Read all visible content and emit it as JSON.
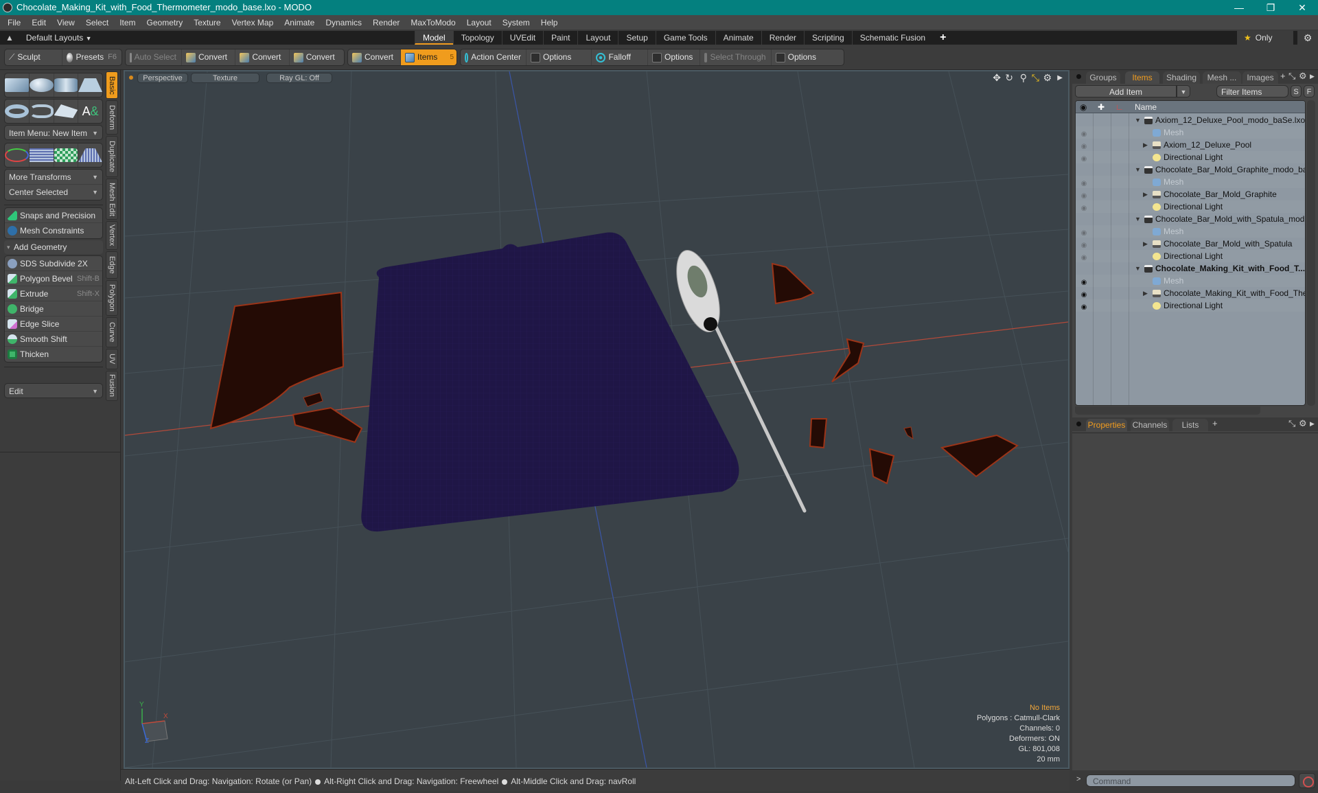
{
  "window": {
    "title": "Chocolate_Making_Kit_with_Food_Thermometer_modo_base.lxo - MODO",
    "controls": [
      "minimize",
      "restore",
      "close"
    ]
  },
  "menu": [
    "File",
    "Edit",
    "View",
    "Select",
    "Item",
    "Geometry",
    "Texture",
    "Vertex Map",
    "Animate",
    "Dynamics",
    "Render",
    "MaxToModo",
    "Layout",
    "System",
    "Help"
  ],
  "layoutbar": {
    "layouts_label": "Default Layouts",
    "tabs": [
      "Model",
      "Topology",
      "UVEdit",
      "Paint",
      "Layout",
      "Setup",
      "Game Tools",
      "Animate",
      "Render",
      "Scripting",
      "Schematic Fusion"
    ],
    "active_tab": "Model",
    "only_label": "Only"
  },
  "toolbar": {
    "sculpt": "Sculpt",
    "presets": "Presets",
    "presets_key": "F6",
    "auto_select": "Auto Select",
    "convert1": "Convert",
    "convert2": "Convert",
    "convert3": "Convert",
    "convert4": "Convert",
    "items": "Items",
    "items_count": "5",
    "action_center": "Action Center",
    "options1": "Options",
    "falloff": "Falloff",
    "options2": "Options",
    "select_through": "Select Through",
    "options3": "Options"
  },
  "leftpanel": {
    "item_menu": "Item Menu: New Item",
    "more_transforms": "More Transforms",
    "center_selected": "Center Selected",
    "snaps": "Snaps and Precision",
    "mesh_constraints": "Mesh Constraints",
    "add_geometry": "Add Geometry",
    "tools": [
      {
        "label": "SDS Subdivide 2X",
        "shortcut": "",
        "color": "#8aa0c0"
      },
      {
        "label": "Polygon Bevel",
        "shortcut": "Shift-B",
        "color": "#3fb56a"
      },
      {
        "label": "Extrude",
        "shortcut": "Shift-X",
        "color": "#3fb56a"
      },
      {
        "label": "Bridge",
        "shortcut": "",
        "color": "#3fb56a"
      },
      {
        "label": "Edge Slice",
        "shortcut": "",
        "color": "#c070c0"
      },
      {
        "label": "Smooth Shift",
        "shortcut": "",
        "color": "#3fb56a"
      },
      {
        "label": "Thicken",
        "shortcut": "",
        "color": "#3fb56a"
      }
    ],
    "edit": "Edit"
  },
  "vtabs": [
    "Basic",
    "Deform",
    "Duplicate",
    "Mesh Edit",
    "Vertex",
    "Edge",
    "Polygon",
    "Curve",
    "UV",
    "Fusion"
  ],
  "viewport": {
    "view_mode": "Perspective",
    "shading": "Texture",
    "raygl": "Ray GL: Off",
    "stats": {
      "items": "No Items",
      "polygons": "Polygons : Catmull-Clark",
      "channels": "Channels: 0",
      "deformers": "Deformers: ON",
      "gl": "GL: 801,008",
      "scale": "20 mm"
    },
    "axis_labels": {
      "x": "X",
      "y": "Y",
      "z": "Z"
    }
  },
  "statusbar": {
    "hint1": "Alt-Left Click and Drag: Navigation: Rotate (or Pan)",
    "hint2": "Alt-Right Click and Drag: Navigation: Freewheel",
    "hint3": "Alt-Middle Click and Drag: navRoll"
  },
  "rightpanel": {
    "top_tabs": [
      "Groups",
      "Items",
      "Shading",
      "Mesh ...",
      "Images"
    ],
    "active_top_tab": "Items",
    "add_item": "Add Item",
    "filter_placeholder": "Filter Items",
    "s_btn": "S",
    "f_btn": "F",
    "name_header": "Name",
    "tree": [
      {
        "label": "Axiom_12_Deluxe_Pool_modo_baSe.lxo",
        "type": "scene",
        "depth": 0,
        "visible": false,
        "bold": false,
        "dim": false
      },
      {
        "label": "Mesh",
        "type": "mesh",
        "depth": 1,
        "visible": false,
        "bold": false,
        "dim": true
      },
      {
        "label": "Axiom_12_Deluxe_Pool",
        "type": "folder",
        "depth": 1,
        "visible": false,
        "bold": false,
        "dim": false,
        "expander": true
      },
      {
        "label": "Directional Light",
        "type": "light",
        "depth": 1,
        "visible": false,
        "bold": false,
        "dim": false
      },
      {
        "label": "Chocolate_Bar_Mold_Graphite_modo_base ...",
        "type": "scene",
        "depth": 0,
        "visible": false,
        "bold": false,
        "dim": false
      },
      {
        "label": "Mesh",
        "type": "mesh",
        "depth": 1,
        "visible": false,
        "bold": false,
        "dim": true
      },
      {
        "label": "Chocolate_Bar_Mold_Graphite",
        "type": "folder",
        "depth": 1,
        "visible": false,
        "bold": false,
        "dim": false,
        "expander": true
      },
      {
        "label": "Directional Light",
        "type": "light",
        "depth": 1,
        "visible": false,
        "bold": false,
        "dim": false
      },
      {
        "label": "Chocolate_Bar_Mold_with_Spatula_modo_ ...",
        "type": "scene",
        "depth": 0,
        "visible": false,
        "bold": false,
        "dim": false
      },
      {
        "label": "Mesh",
        "type": "mesh",
        "depth": 1,
        "visible": false,
        "bold": false,
        "dim": true
      },
      {
        "label": "Chocolate_Bar_Mold_with_Spatula",
        "type": "folder",
        "depth": 1,
        "visible": false,
        "bold": false,
        "dim": false,
        "expander": true
      },
      {
        "label": "Directional Light",
        "type": "light",
        "depth": 1,
        "visible": false,
        "bold": false,
        "dim": false
      },
      {
        "label": "Chocolate_Making_Kit_with_Food_T...",
        "type": "scene",
        "depth": 0,
        "visible": true,
        "bold": true,
        "dim": false
      },
      {
        "label": "Mesh",
        "type": "mesh",
        "depth": 1,
        "visible": true,
        "bold": false,
        "dim": true
      },
      {
        "label": "Chocolate_Making_Kit_with_Food_Ther  ...",
        "type": "folder",
        "depth": 1,
        "visible": true,
        "bold": false,
        "dim": false,
        "expander": true
      },
      {
        "label": "Directional Light",
        "type": "light",
        "depth": 1,
        "visible": true,
        "bold": false,
        "dim": false
      }
    ],
    "bottom_tabs": [
      "Properties",
      "Channels",
      "Lists"
    ],
    "active_bottom_tab": "Properties",
    "command_placeholder": "Command"
  },
  "colors": {
    "titlebar": "#04807f",
    "accent": "#f09c1d",
    "viewport_bg": "#3a4248",
    "mold": "#1f1646",
    "chocolate": "#2a0d06",
    "chocolate_edge": "#b8401c"
  }
}
